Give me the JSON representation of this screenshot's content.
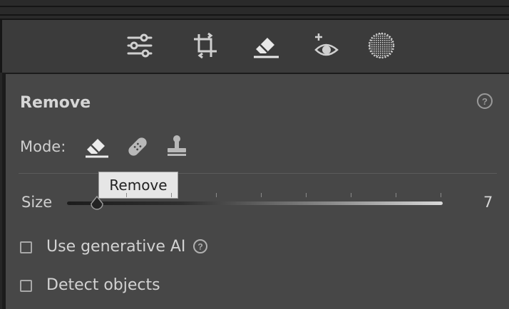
{
  "toolstrip": {
    "tools": [
      {
        "icon": "sliders-icon",
        "label": "Edit"
      },
      {
        "icon": "crop-rotate-icon",
        "label": "Crop"
      },
      {
        "icon": "eraser-icon",
        "label": "Remove"
      },
      {
        "icon": "red-eye-icon",
        "label": "Red Eye"
      },
      {
        "icon": "masking-icon",
        "label": "Masking"
      }
    ]
  },
  "panel": {
    "title": "Remove",
    "mode_label": "Mode:",
    "modes": [
      {
        "icon": "eraser-icon",
        "label": "Remove",
        "selected": true
      },
      {
        "icon": "bandage-icon",
        "label": "Heal",
        "selected": false
      },
      {
        "icon": "clone-stamp-icon",
        "label": "Clone",
        "selected": false
      }
    ],
    "tooltip": "Remove",
    "size": {
      "label": "Size",
      "value": "7",
      "fraction": 0.08
    },
    "use_generative_ai": {
      "label": "Use generative AI",
      "checked": false
    },
    "detect_objects": {
      "label": "Detect objects",
      "checked": false
    }
  }
}
